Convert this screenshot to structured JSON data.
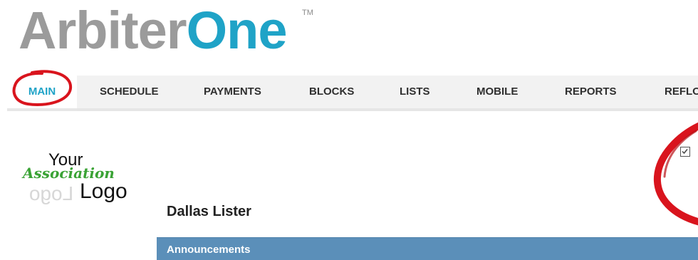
{
  "brand": {
    "part1": "Arbiter",
    "part2": "One",
    "trademark": "TM",
    "colors": {
      "gray": "#9b9b9b",
      "blue": "#1fa3c7"
    }
  },
  "nav": {
    "tabs": [
      {
        "label": "MAIN",
        "active": true
      },
      {
        "label": "SCHEDULE",
        "active": false
      },
      {
        "label": "PAYMENTS",
        "active": false
      },
      {
        "label": "BLOCKS",
        "active": false
      },
      {
        "label": "LISTS",
        "active": false
      },
      {
        "label": "MOBILE",
        "active": false
      },
      {
        "label": "REPORTS",
        "active": false
      },
      {
        "label": "REFLO",
        "active": false
      }
    ]
  },
  "association_logo": {
    "line1": "Your",
    "line2": "Association",
    "line3": "Logo",
    "reflection": "Logo",
    "accent_color": "#3aa335"
  },
  "user": {
    "name": "Dallas Lister"
  },
  "announcements": {
    "label": "Announcements",
    "bar_color": "#5b8fb9"
  },
  "checkbox": {
    "icon": "checkbox-checked-icon",
    "checked": true
  },
  "annotations": {
    "highlight_color": "#d9141d"
  }
}
